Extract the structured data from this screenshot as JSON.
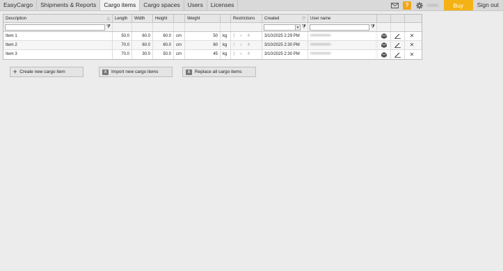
{
  "nav": {
    "tabs": [
      {
        "label": "EasyCargo",
        "active": false
      },
      {
        "label": "Shipments & Reports",
        "active": false
      },
      {
        "label": "Cargo items",
        "active": true
      },
      {
        "label": "Cargo spaces",
        "active": false
      },
      {
        "label": "Users",
        "active": false
      },
      {
        "label": "Licenses",
        "active": false
      }
    ],
    "help_label": "?",
    "user_name_blurred": "••••••",
    "buy_label": "Buy",
    "signout_label": "Sign out"
  },
  "grid": {
    "headers": {
      "description": "Description",
      "length": "Length",
      "width": "Width",
      "height": "Height",
      "weight": "Weight",
      "restrictions": "Restrictions",
      "created": "Created",
      "user_name": "User name"
    },
    "rows": [
      {
        "description": "Item 1",
        "length": "50.0",
        "width": "60.0",
        "height": "60.0",
        "dim_unit": "cm",
        "weight": "50",
        "weight_unit": "kg",
        "created": "3/10/2025 2:29 PM",
        "user": "••••••••••••••"
      },
      {
        "description": "Item 2",
        "length": "70.0",
        "width": "60.0",
        "height": "60.0",
        "dim_unit": "cm",
        "weight": "60",
        "weight_unit": "kg",
        "created": "3/10/2025 2:30 PM",
        "user": "••••••••••••••"
      },
      {
        "description": "Item 3",
        "length": "70.0",
        "width": "30.0",
        "height": "50.0",
        "dim_unit": "cm",
        "weight": "45",
        "weight_unit": "kg",
        "created": "3/10/2025 2:30 PM",
        "user": "••••••••••••••"
      }
    ]
  },
  "buttons": {
    "create": "Create new cargo item",
    "import": "Import new cargo items",
    "replace": "Replace all cargo items"
  },
  "colors": {
    "accent": "#f4b215",
    "background": "#ececec"
  }
}
